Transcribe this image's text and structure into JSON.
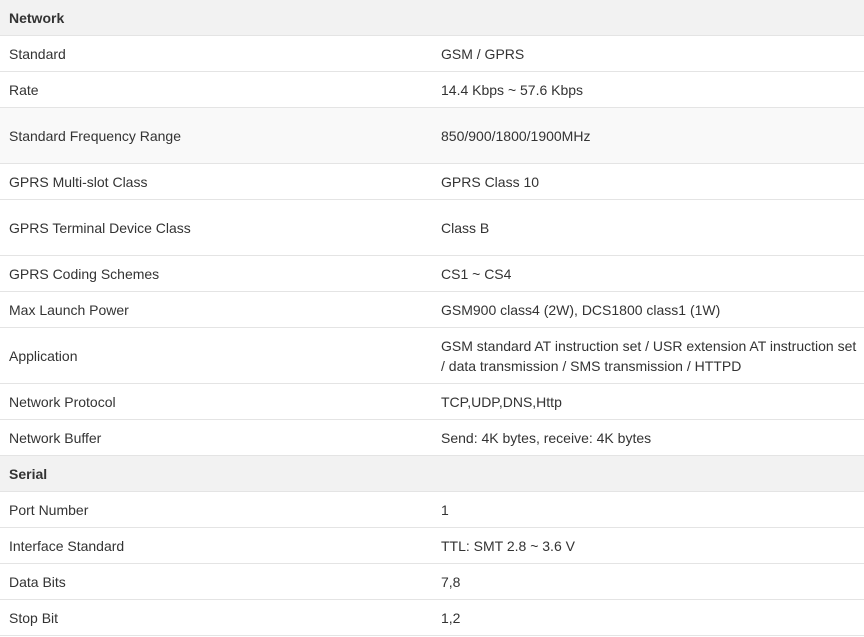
{
  "sections": [
    {
      "title": "Network",
      "rows": [
        {
          "key": "Standard",
          "value": "GSM / GPRS"
        },
        {
          "key": "Rate",
          "value": "14.4 Kbps ~ 57.6 Kbps"
        },
        {
          "key": "Standard Frequency Range",
          "value": "850/900/1800/1900MHz"
        },
        {
          "key": "GPRS Multi-slot Class",
          "value": "GPRS Class 10"
        },
        {
          "key": "GPRS Terminal Device Class",
          "value": "Class B"
        },
        {
          "key": "GPRS Coding Schemes",
          "value": "CS1 ~ CS4"
        },
        {
          "key": "Max Launch Power",
          "value": "GSM900 class4 (2W), DCS1800 class1 (1W)"
        },
        {
          "key": "Application",
          "value": "GSM standard AT instruction set / USR extension AT instruction set / data transmission / SMS transmission / HTTPD"
        },
        {
          "key": "Network Protocol",
          "value": "TCP,UDP,DNS,Http"
        },
        {
          "key": "Network Buffer",
          "value": "Send: 4K bytes, receive: 4K bytes"
        }
      ]
    },
    {
      "title": "Serial",
      "rows": [
        {
          "key": "Port Number",
          "value": "1"
        },
        {
          "key": "Interface Standard",
          "value": "TTL: SMT 2.8 ~ 3.6 V"
        },
        {
          "key": "Data Bits",
          "value": "7,8"
        },
        {
          "key": "Stop Bit",
          "value": "1,2"
        }
      ]
    }
  ]
}
